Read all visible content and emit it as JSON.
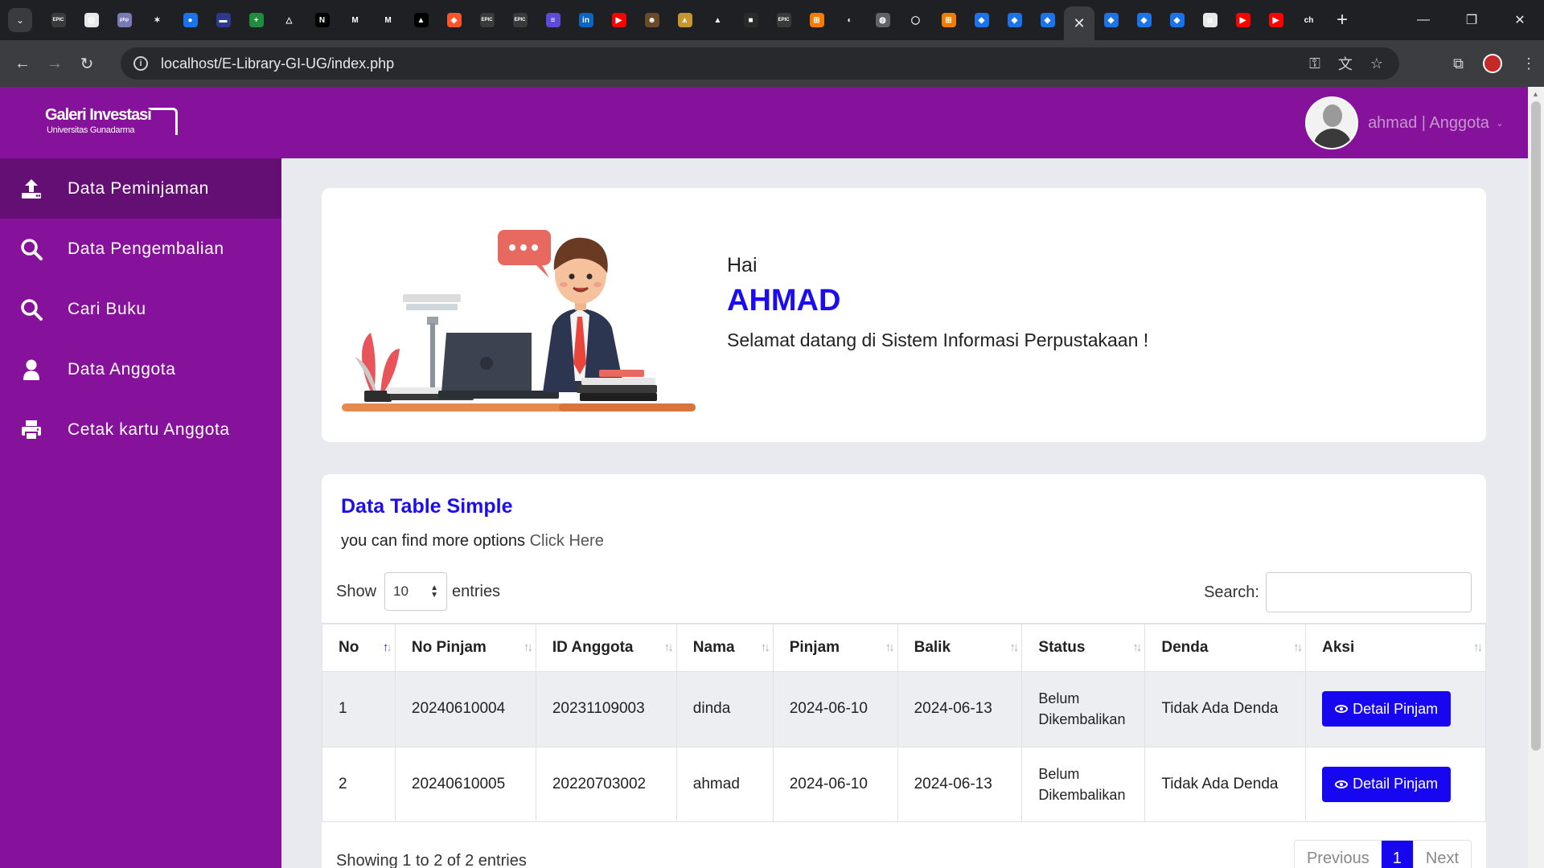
{
  "browser": {
    "url": "localhost/E-Library-GI-UG/index.php",
    "tab_favicons": [
      {
        "icon": "epic-games-icon",
        "color": "#3a3a3a",
        "glyph": "EPIC"
      },
      {
        "icon": "chatgpt-icon",
        "color": "#e8e8e8",
        "glyph": "◎"
      },
      {
        "icon": "php-icon",
        "color": "#777bb3",
        "glyph": "php"
      },
      {
        "icon": "star-icon",
        "color": "#1f2023",
        "glyph": "✶"
      },
      {
        "icon": "blue-circle-icon",
        "color": "#1a73e8",
        "glyph": "●"
      },
      {
        "icon": "flag-icon",
        "color": "#2b3a8c",
        "glyph": "▬"
      },
      {
        "icon": "sheets-icon",
        "color": "#1e8e3e",
        "glyph": "+"
      },
      {
        "icon": "drive-icon",
        "color": "#1f2023",
        "glyph": "△"
      },
      {
        "icon": "notion-icon",
        "color": "#000000",
        "glyph": "N"
      },
      {
        "icon": "gmail-icon",
        "color": "#1f2023",
        "glyph": "M"
      },
      {
        "icon": "gmail-icon",
        "color": "#1f2023",
        "glyph": "M"
      },
      {
        "icon": "triangle-icon",
        "color": "#000000",
        "glyph": "▲"
      },
      {
        "icon": "brave-icon",
        "color": "#fb542b",
        "glyph": "◈"
      },
      {
        "icon": "epic-games-icon",
        "color": "#3a3a3a",
        "glyph": "EPIC"
      },
      {
        "icon": "epic-games-icon",
        "color": "#3a3a3a",
        "glyph": "EPIC"
      },
      {
        "icon": "list-icon",
        "color": "#5b4bdb",
        "glyph": "≡"
      },
      {
        "icon": "linkedin-icon",
        "color": "#0a66c2",
        "glyph": "in"
      },
      {
        "icon": "youtube-icon",
        "color": "#ff0000",
        "glyph": "▶"
      },
      {
        "icon": "mascot-icon",
        "color": "#6b4a2a",
        "glyph": "☻"
      },
      {
        "icon": "mountain-icon",
        "color": "#c9962e",
        "glyph": "⩚"
      },
      {
        "icon": "triangle-icon",
        "color": "#1f2023",
        "glyph": "▲"
      },
      {
        "icon": "dark-square-icon",
        "color": "#2a2a2a",
        "glyph": "■"
      },
      {
        "icon": "epic-games-icon",
        "color": "#3a3a3a",
        "glyph": "EPIC"
      },
      {
        "icon": "orange-app-icon",
        "color": "#f57c00",
        "glyph": "⊞"
      },
      {
        "icon": "github-icon",
        "color": "#1f2023",
        "glyph": "◐"
      },
      {
        "icon": "globe-icon",
        "color": "#5f6368",
        "glyph": "◍"
      },
      {
        "icon": "red-ring-icon",
        "color": "#1f2023",
        "glyph": "◯"
      },
      {
        "icon": "orange-app-icon",
        "color": "#f57c00",
        "glyph": "⊞"
      },
      {
        "icon": "cube-icon",
        "color": "#1a73e8",
        "glyph": "◆"
      },
      {
        "icon": "cube-icon",
        "color": "#1a73e8",
        "glyph": "◆"
      },
      {
        "icon": "cube-icon",
        "color": "#1a73e8",
        "glyph": "◆"
      }
    ],
    "tab_favicons_after": [
      {
        "icon": "cube-icon",
        "color": "#1a73e8",
        "glyph": "◆"
      },
      {
        "icon": "cube-icon",
        "color": "#1a73e8",
        "glyph": "◆"
      },
      {
        "icon": "cube-icon",
        "color": "#1a73e8",
        "glyph": "◆"
      },
      {
        "icon": "slash-icon",
        "color": "#e8e8e8",
        "glyph": "⧄"
      },
      {
        "icon": "youtube-icon",
        "color": "#ff0000",
        "glyph": "▶"
      },
      {
        "icon": "youtube-icon",
        "color": "#ff0000",
        "glyph": "▶"
      },
      {
        "icon": "ch-text-icon",
        "color": "#1f2023",
        "glyph": "ch"
      }
    ]
  },
  "header": {
    "logo_line1": "Galeri Investasi",
    "logo_line2": "Universitas Gunadarma",
    "user_label": "ahmad | Anggota"
  },
  "sidebar": {
    "items": [
      {
        "label": "Data Peminjaman",
        "icon": "upload-icon",
        "active": true
      },
      {
        "label": "Data Pengembalian",
        "icon": "search-icon",
        "active": false
      },
      {
        "label": "Cari Buku",
        "icon": "search-icon",
        "active": false
      },
      {
        "label": "Data Anggota",
        "icon": "user-icon",
        "active": false
      },
      {
        "label": "Cetak kartu Anggota",
        "icon": "printer-icon",
        "active": false
      }
    ]
  },
  "hero": {
    "greeting": "Hai",
    "name": "AHMAD",
    "welcome": "Selamat datang di Sistem Informasi Perpustakaan !"
  },
  "table_card": {
    "title": "Data Table Simple",
    "subtitle": "you can find more options",
    "subtitle_link": "Click Here",
    "show_label": "Show",
    "entries_label": "entries",
    "page_length": "10",
    "search_label": "Search:",
    "search_value": "",
    "columns": [
      "No",
      "No Pinjam",
      "ID Anggota",
      "Nama",
      "Pinjam",
      "Balik",
      "Status",
      "Denda",
      "Aksi"
    ],
    "rows": [
      {
        "no": "1",
        "no_pinjam": "20240610004",
        "id_anggota": "20231109003",
        "nama": "dinda",
        "pinjam": "2024-06-10",
        "balik": "2024-06-13",
        "status": "Belum Dikembalikan",
        "denda": "Tidak Ada Denda",
        "aksi": "Detail Pinjam"
      },
      {
        "no": "2",
        "no_pinjam": "20240610005",
        "id_anggota": "20220703002",
        "nama": "ahmad",
        "pinjam": "2024-06-10",
        "balik": "2024-06-13",
        "status": "Belum Dikembalikan",
        "denda": "Tidak Ada Denda",
        "aksi": "Detail Pinjam"
      }
    ],
    "info": "Showing 1 to 2 of 2 entries",
    "pager": {
      "previous": "Previous",
      "current": "1",
      "next": "Next"
    }
  },
  "colors": {
    "brand_purple": "#86119a",
    "active_purple": "#640f73",
    "accent_blue": "#1706f0",
    "denda_green": "#0d8a2b"
  }
}
